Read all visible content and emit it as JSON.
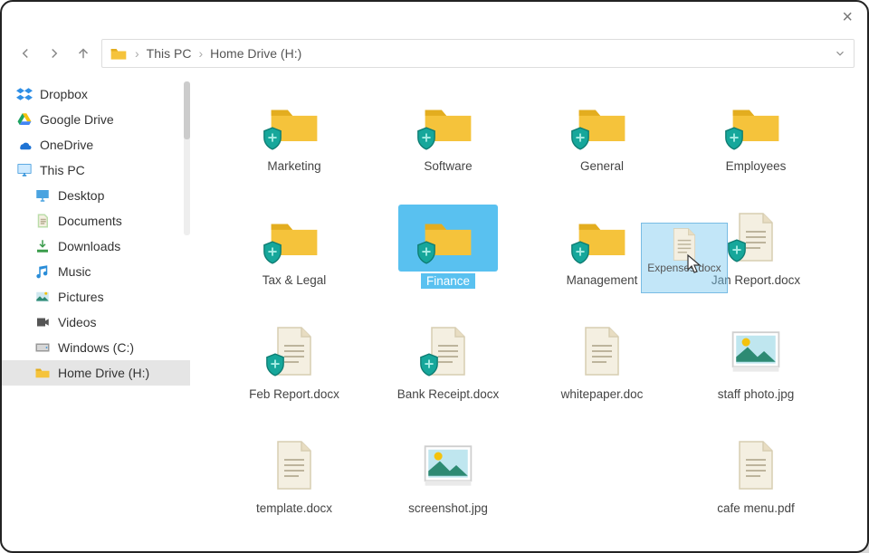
{
  "title_bar": {
    "close_label": "×"
  },
  "nav": {
    "crumbs": [
      "This PC",
      "Home Drive (H:)"
    ]
  },
  "sidebar": {
    "items": [
      {
        "label": "Dropbox",
        "icon": "dropbox"
      },
      {
        "label": "Google Drive",
        "icon": "gdrive"
      },
      {
        "label": "OneDrive",
        "icon": "onedrive"
      },
      {
        "label": "This PC",
        "icon": "monitor"
      },
      {
        "label": "Desktop",
        "icon": "desktop",
        "sub": true
      },
      {
        "label": "Documents",
        "icon": "documents",
        "sub": true
      },
      {
        "label": "Downloads",
        "icon": "downloads",
        "sub": true
      },
      {
        "label": "Music",
        "icon": "music",
        "sub": true
      },
      {
        "label": "Pictures",
        "icon": "pictures",
        "sub": true
      },
      {
        "label": "Videos",
        "icon": "videos",
        "sub": true
      },
      {
        "label": "Windows (C:)",
        "icon": "disk",
        "sub": true
      },
      {
        "label": "Home Drive (H:)",
        "icon": "hfolder",
        "sub": true,
        "selected": true
      }
    ]
  },
  "folder_view": {
    "items": [
      {
        "label": "Marketing",
        "type": "folder_shield"
      },
      {
        "label": "Software",
        "type": "folder_shield"
      },
      {
        "label": "General",
        "type": "folder_shield"
      },
      {
        "label": "Employees",
        "type": "folder_shield"
      },
      {
        "label": "Tax & Legal",
        "type": "folder_shield"
      },
      {
        "label": "Finance",
        "type": "folder_shield",
        "selected": true
      },
      {
        "label": "Management",
        "type": "folder_shield"
      },
      {
        "label": "Jan Report.docx",
        "type": "doc_shield"
      },
      {
        "label": "Feb Report.docx",
        "type": "doc_shield"
      },
      {
        "label": "Bank Receipt.docx",
        "type": "doc_shield"
      },
      {
        "label": "whitepaper.doc",
        "type": "doc"
      },
      {
        "label": "staff photo.jpg",
        "type": "image"
      },
      {
        "label": "template.docx",
        "type": "doc"
      },
      {
        "label": "screenshot.jpg",
        "type": "image"
      },
      {
        "label": "",
        "type": "blank"
      },
      {
        "label": "cafe menu.pdf",
        "type": "doc"
      }
    ],
    "drag_ghost": {
      "label": "Expenses.docx"
    }
  },
  "colors": {
    "folder": "#f5c33b",
    "folder_dark": "#e3ad1f",
    "shield": "#16a79b",
    "doc_fill": "#f4efe1",
    "doc_lines": "#bdb49c",
    "select_bg": "#59c1f0",
    "drag_bg": "rgba(120,200,240,0.45)"
  }
}
